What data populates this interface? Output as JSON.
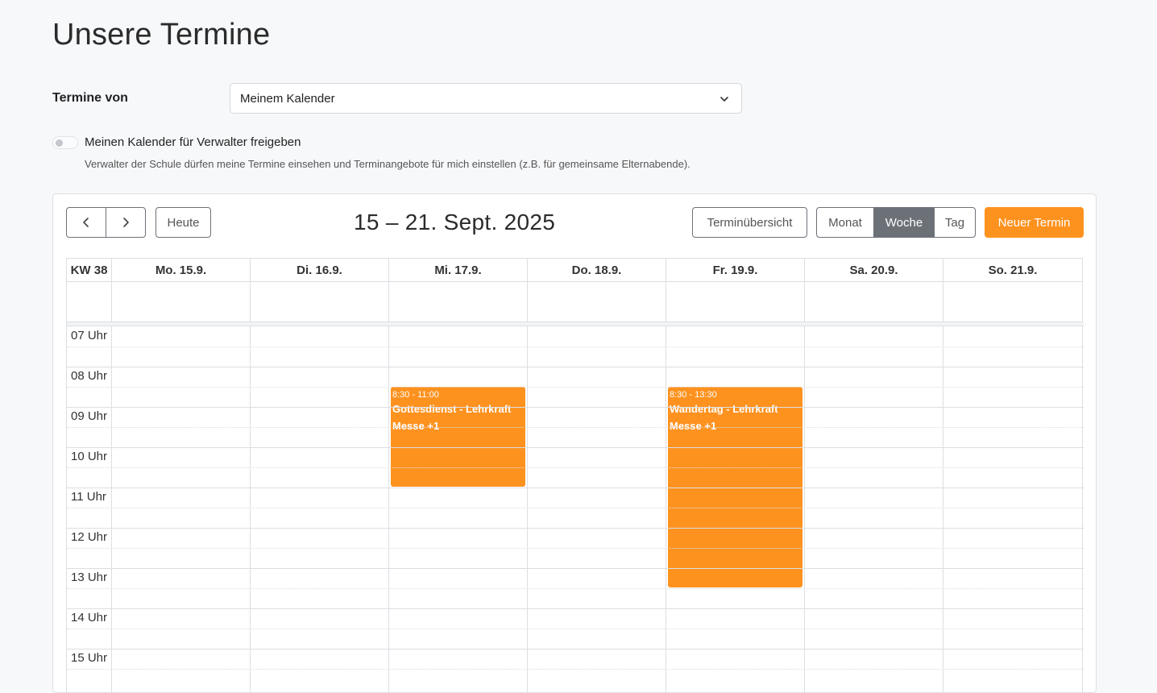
{
  "page": {
    "title": "Unsere Termine"
  },
  "filter": {
    "label": "Termine von",
    "selected": "Meinem Kalender"
  },
  "share": {
    "label": "Meinen Kalender für Verwalter freigeben",
    "help": "Verwalter der Schule dürfen meine Termine einsehen und Terminangebote für mich einstellen (z.B. für gemeinsame Elternabende).",
    "enabled": false
  },
  "toolbar": {
    "today": "Heute",
    "range": "15 – 21. Sept. 2025",
    "overview": "Terminübersicht",
    "month": "Monat",
    "week": "Woche",
    "day": "Tag",
    "new_event": "Neuer Termin",
    "active_view": "Woche"
  },
  "calendar": {
    "week_label": "KW 38",
    "days": [
      "Mo. 15.9.",
      "Di. 16.9.",
      "Mi. 17.9.",
      "Do. 18.9.",
      "Fr. 19.9.",
      "Sa. 20.9.",
      "So. 21.9."
    ],
    "hours": [
      "07 Uhr",
      "08 Uhr",
      "09 Uhr",
      "10 Uhr",
      "11 Uhr",
      "12 Uhr",
      "13 Uhr",
      "14 Uhr",
      "15 Uhr"
    ],
    "events": [
      {
        "day": "Mi. 17.9.",
        "time": "8:30 - 11:00",
        "title": "Gottesdienst - Lehrkraft",
        "extra": "Messe +1",
        "start": 8.5,
        "end": 11.0
      },
      {
        "day": "Fr. 19.9.",
        "time": "8:30 - 13:30",
        "title": "Wandertag - Lehrkraft",
        "extra": "Messe +1",
        "start": 8.5,
        "end": 13.5
      }
    ]
  },
  "colors": {
    "accent": "#fe921f",
    "active_button": "#6c7178",
    "border": "#dcdee2"
  }
}
